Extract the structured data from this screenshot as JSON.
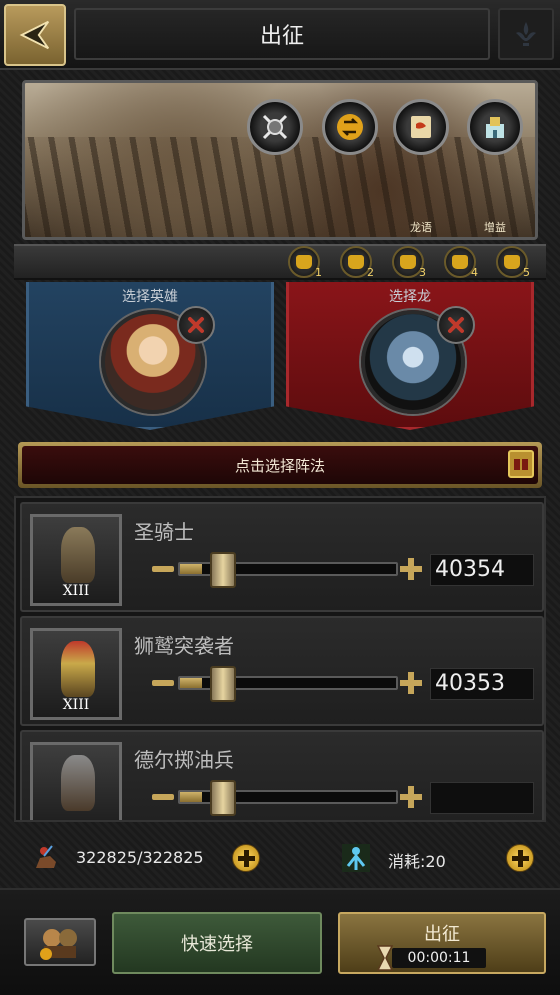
{
  "header": {
    "title": "出征"
  },
  "banner": {
    "icons": [
      {
        "name": "swords-shield-icon",
        "label": ""
      },
      {
        "name": "swap-icon",
        "label": ""
      },
      {
        "name": "dragon-scroll-icon",
        "label": "龙语"
      },
      {
        "name": "castle-boost-icon",
        "label": "增益"
      }
    ]
  },
  "presets": [
    "1",
    "2",
    "3",
    "4",
    "5"
  ],
  "hero": {
    "label": "选择英雄"
  },
  "dragon": {
    "label": "选择龙"
  },
  "formation": {
    "label": "点击选择阵法"
  },
  "troops": [
    {
      "name": "圣骑士",
      "tier": "XIII",
      "value": "40354",
      "fraction": 0.1
    },
    {
      "name": "狮鹫突袭者",
      "tier": "XIII",
      "value": "40353",
      "fraction": 0.1
    },
    {
      "name": "德尔掷油兵",
      "tier": "",
      "value": "",
      "fraction": 0.1
    }
  ],
  "summary": {
    "troops": "322825/322825",
    "cost": "消耗:20"
  },
  "actions": {
    "quick_select": "快速选择",
    "march": "出征",
    "march_time": "00:00:11"
  },
  "colors": {
    "gold": "#c6a65a",
    "hero_panel": "#1f3d5c",
    "dragon_panel": "#7a1114"
  }
}
